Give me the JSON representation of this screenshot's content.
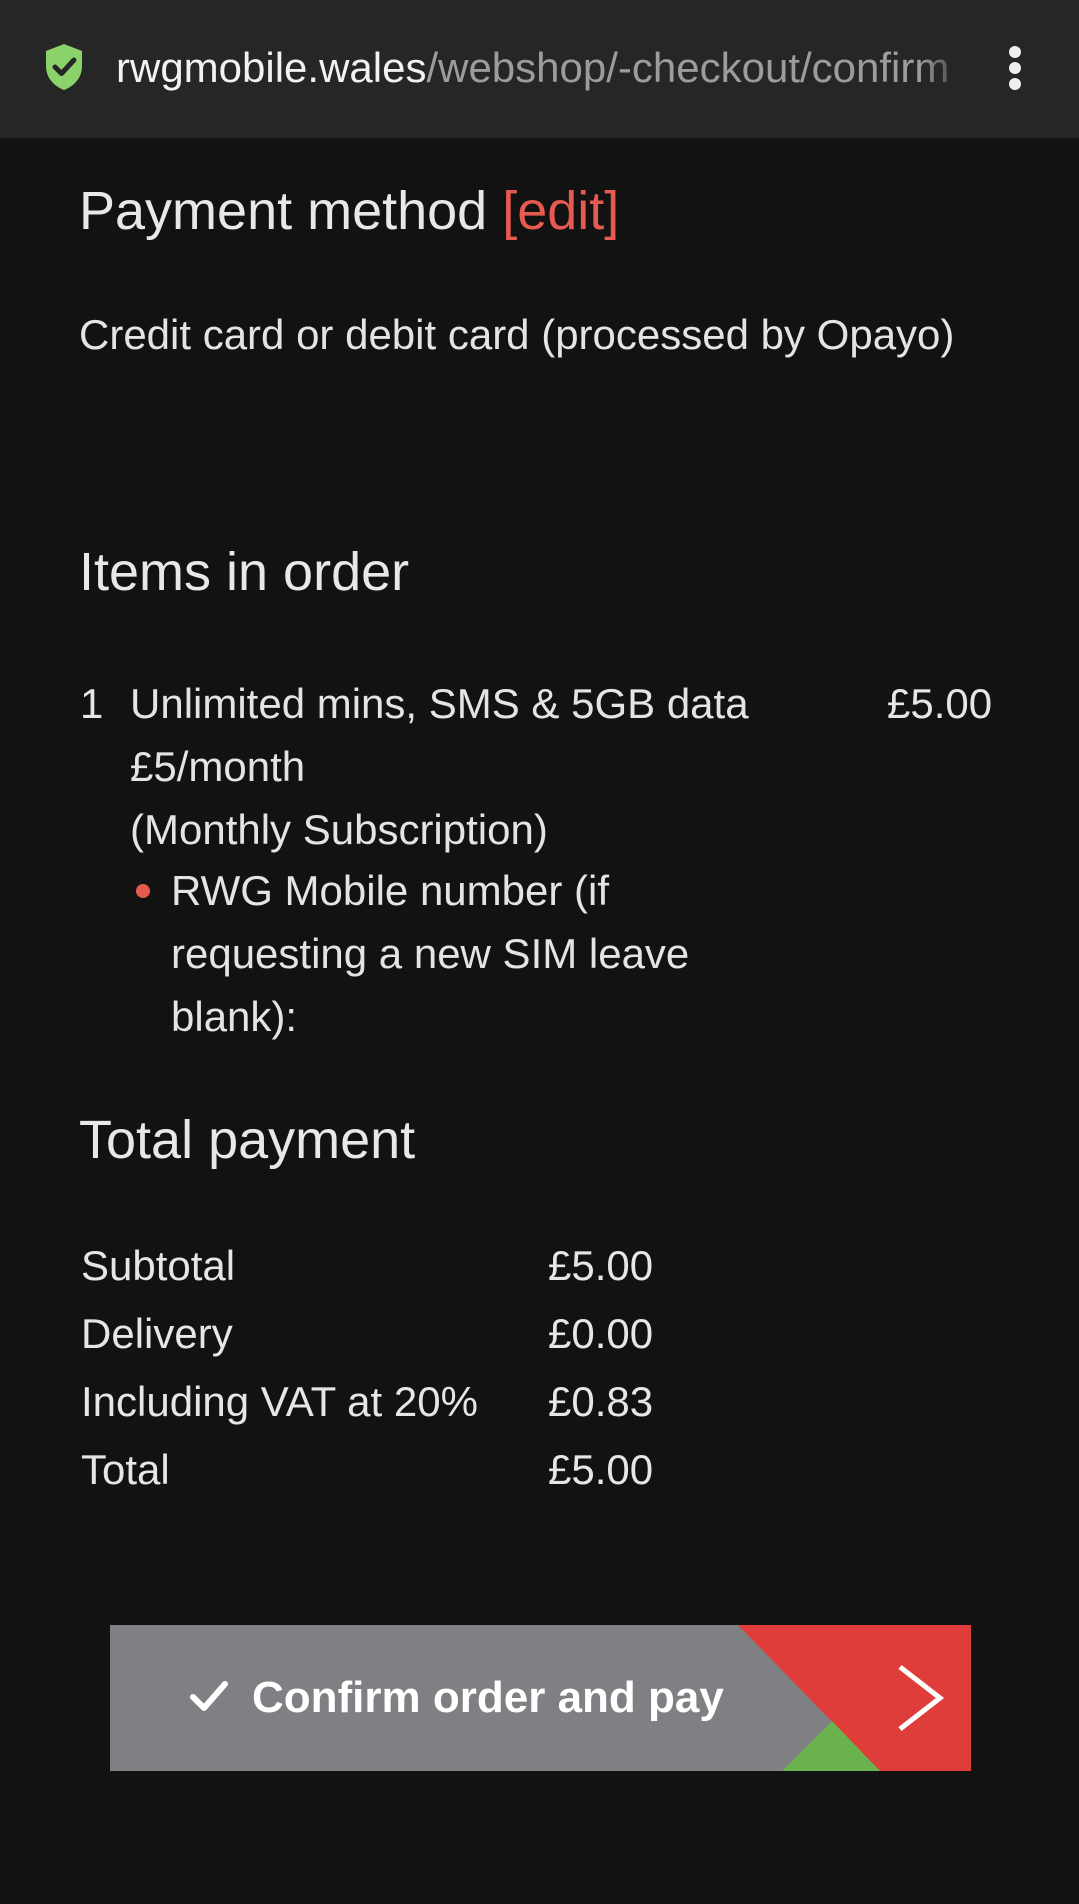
{
  "browser": {
    "url_host": "rwgmobile.wales",
    "url_path": "/webshop/-checkout/confirm"
  },
  "payment": {
    "heading": "Payment method",
    "edit_label": "[edit]",
    "method_text": "Credit card or debit card (processed by Opayo)"
  },
  "items": {
    "heading": "Items in order",
    "list": [
      {
        "qty": "1",
        "name": "Unlimited mins, SMS & 5GB data £5/month",
        "subscription": "(Monthly Subscription)",
        "price": "£5.00",
        "option": "RWG Mobile number (if requesting a new SIM leave blank):"
      }
    ]
  },
  "totals": {
    "heading": "Total payment",
    "rows": [
      {
        "label": "Subtotal",
        "value": "£5.00"
      },
      {
        "label": "Delivery",
        "value": "£0.00"
      },
      {
        "label": "Including VAT at 20%",
        "value": "£0.83"
      },
      {
        "label": "Total",
        "value": "£5.00"
      }
    ]
  },
  "confirm": {
    "label": "Confirm order and pay"
  },
  "colors": {
    "accent_red": "#e65a4f",
    "button_grey": "#7e8083",
    "button_red": "#de3d39",
    "button_green": "#6ab24e",
    "shield_green": "#8bd26a"
  },
  "icons": {
    "shield": "shield-check-icon",
    "menu": "more-vert-icon",
    "check": "check-icon",
    "chevron": "chevron-right-icon"
  }
}
